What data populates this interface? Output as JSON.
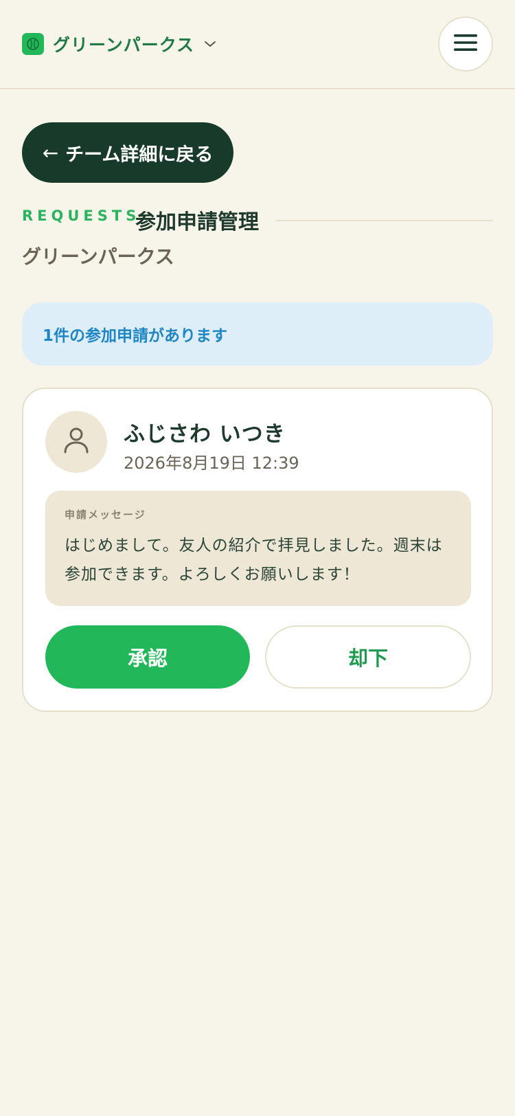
{
  "header": {
    "team_name": "グリーンパークス",
    "logo_icon": "tennis-ball-icon",
    "dropdown_icon": "chevron-down-icon",
    "menu_icon": "hamburger-menu-icon"
  },
  "back_button": {
    "arrow": "←",
    "label": "チーム詳細に戻る"
  },
  "section": {
    "eyebrow": "REQUESTS",
    "title": "参加申請管理",
    "team": "グリーンパークス"
  },
  "banner": {
    "text": "1件の参加申請があります"
  },
  "requests": [
    {
      "avatar_icon": "user-icon",
      "name": "ふじさわ いつき",
      "applied_at": "2026年8月19日 12:39",
      "message_label": "申請メッセージ",
      "message": "はじめまして。友人の紹介で拝見しました。週末は参加できます。よろしくお願いします！",
      "approve_label": "承認",
      "reject_label": "却下"
    }
  ],
  "colors": {
    "background": "#f7f4e9",
    "brand_green": "#22b85a",
    "dark_green": "#183a2b",
    "info_blue": "#1f86c4",
    "info_bg": "#deeef8"
  }
}
